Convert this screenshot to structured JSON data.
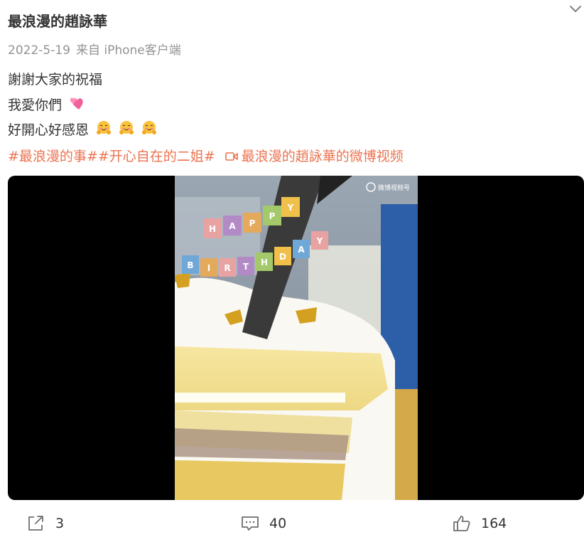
{
  "post": {
    "author": "最浪漫的趙詠華",
    "date": "2022-5-19",
    "source": "来自 iPhone客户端",
    "lines": [
      "謝謝大家的祝福",
      "我愛你們",
      "好開心好感恩"
    ],
    "tags": [
      "#最浪漫的事#",
      "#开心自在的二姐#"
    ],
    "video_link": "最浪漫的趙詠華的微博视频"
  },
  "video": {
    "watermark": "微博视频号",
    "banner_top": [
      "H",
      "A",
      "P",
      "P",
      "Y"
    ],
    "banner_bottom": [
      "B",
      "I",
      "R",
      "T",
      "H",
      "D",
      "A",
      "Y"
    ]
  },
  "actions": {
    "share_count": "3",
    "comment_count": "40",
    "like_count": "164"
  },
  "icons": [
    "chevron-down-icon",
    "two-hearts-icon",
    "hugging-face-icon",
    "video-camera-icon",
    "share-icon",
    "comment-icon",
    "thumbs-up-icon"
  ],
  "colors": {
    "accent": "#eb7350",
    "text": "#333333",
    "meta": "#939393"
  }
}
